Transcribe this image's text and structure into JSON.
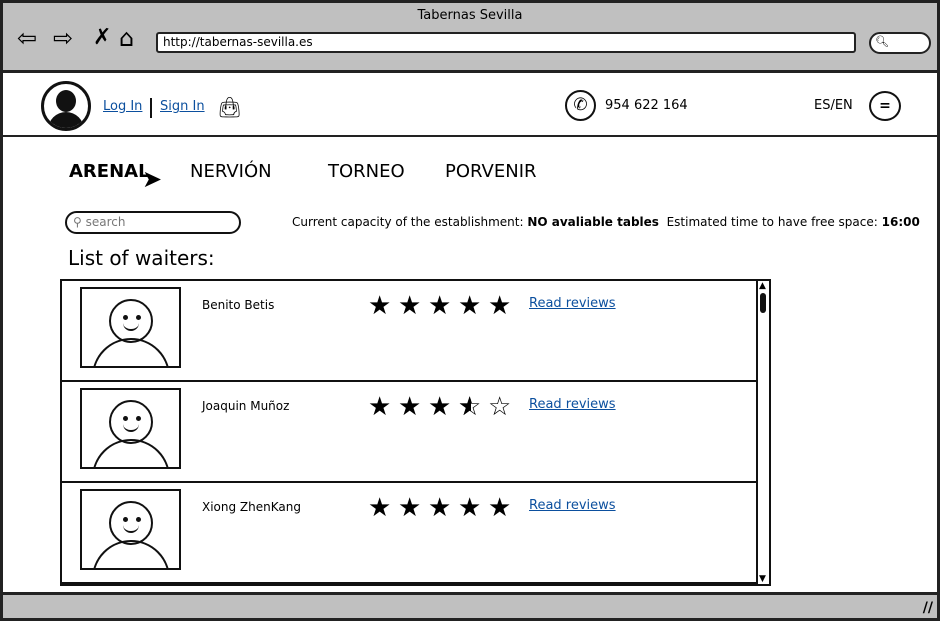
{
  "browser": {
    "title": "Tabernas Sevilla",
    "url": "http://tabernas-sevilla.es",
    "search_icon": "search-icon"
  },
  "header": {
    "login": "Log In",
    "signin": "Sign In",
    "phone": "954 622 164",
    "language": "ES/EN",
    "menu_label": "="
  },
  "tabs": [
    {
      "label": "ARENAL",
      "active": true
    },
    {
      "label": "NERVIÓN"
    },
    {
      "label": "TORNEO"
    },
    {
      "label": "PORVENIR"
    }
  ],
  "search": {
    "placeholder": "search"
  },
  "capacity": {
    "label": "Current capacity of the establishment:",
    "value": "NO avaliable tables",
    "time_label": "Estimated time to have free space:",
    "time_value": "16:00"
  },
  "list_heading": "List of waiters:",
  "waiters": [
    {
      "name": "Benito Betis",
      "rating": 5,
      "link": "Read reviews"
    },
    {
      "name": "Joaquin Muñoz",
      "rating": 3.5,
      "link": "Read reviews"
    },
    {
      "name": "Xiong ZhenKang",
      "rating": 5,
      "link": "Read reviews"
    }
  ]
}
